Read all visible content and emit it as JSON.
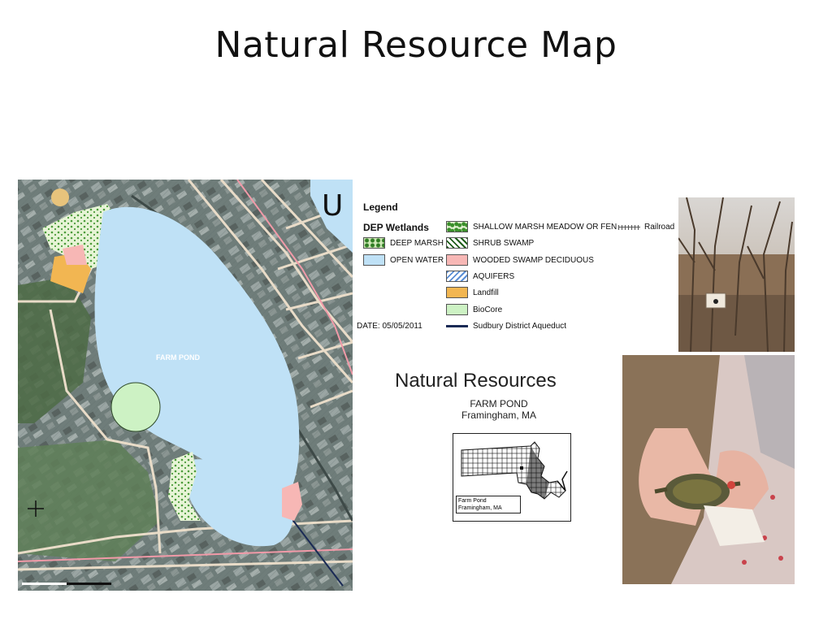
{
  "slide": {
    "title": "Natural Resource Map"
  },
  "map": {
    "corner_letter": "U",
    "pond_label": "FARM POND",
    "colors": {
      "water": "#bfe1f6",
      "land": "#7d8a86",
      "roads": "#e9dcc8",
      "wetland": "#e7f4d6",
      "swamp": "#f7b7b5",
      "landfill": "#f2b652",
      "biocore": "#cdf2c4"
    }
  },
  "legend": {
    "title": "Legend",
    "subtitle": "DEP Wetlands",
    "items": [
      {
        "label": "SHALLOW MARSH MEADOW OR FEN",
        "icon": "shallow-marsh-swatch"
      },
      {
        "label": "Railroad",
        "icon": "railroad-line"
      },
      {
        "label": "DEEP MARSH",
        "icon": "deep-marsh-swatch"
      },
      {
        "label": "SHRUB SWAMP",
        "icon": "shrub-swamp-swatch"
      },
      {
        "label": "OPEN WATER",
        "icon": "open-water-swatch"
      },
      {
        "label": "WOODED SWAMP DECIDUOUS",
        "icon": "wooded-swamp-swatch"
      },
      {
        "label": "AQUIFERS",
        "icon": "aquifer-swatch"
      },
      {
        "label": "Landfill",
        "icon": "landfill-swatch"
      },
      {
        "label": "BioCore",
        "icon": "biocore-swatch"
      },
      {
        "label": "Sudbury District Aqueduct",
        "icon": "aqueduct-line"
      }
    ],
    "date": "DATE:  05/05/2011"
  },
  "title_block": {
    "heading": "Natural Resources",
    "place_line1": "FARM POND",
    "place_line2": "Framingham, MA",
    "locator_line1": "Farm Pond",
    "locator_line2": "Framingham, MA"
  }
}
